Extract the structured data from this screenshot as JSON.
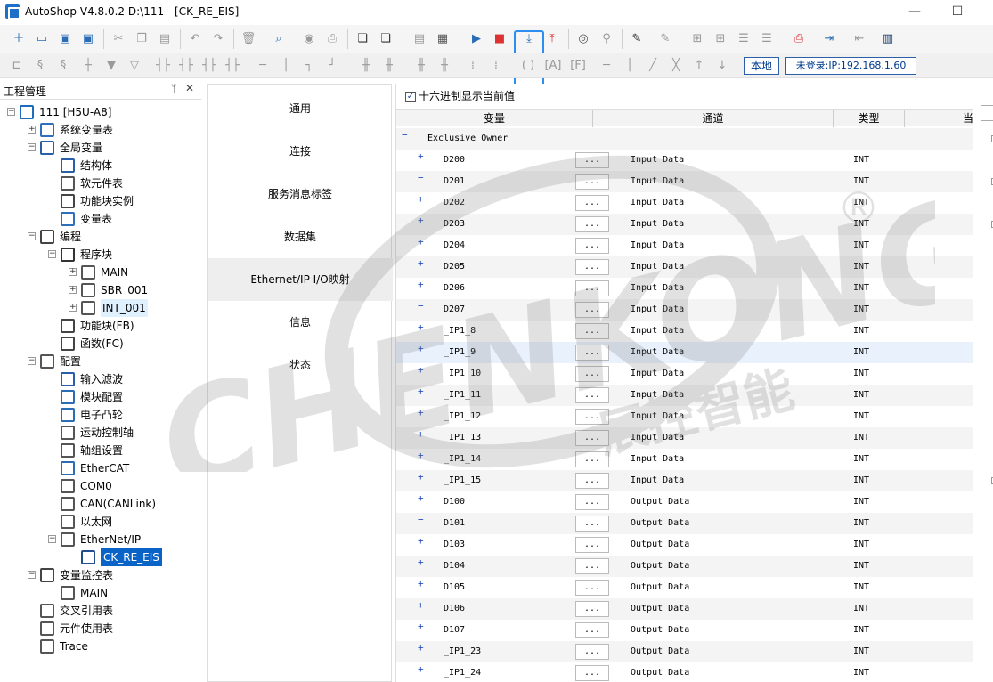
{
  "window": {
    "title": "AutoShop V4.8.0.2  D:\\111 - [CK_RE_EIS]",
    "minimize": "—",
    "maximize": "☐"
  },
  "toolbar": {
    "local_label": "本地",
    "login_label": "未登录:IP:192.168.1.60",
    "icons": [
      "new-file-icon",
      "open-folder-icon",
      "save-icon",
      "save-all-icon",
      "cut-icon",
      "copy-icon",
      "paste-icon",
      "undo-icon",
      "redo-icon",
      "delete-icon",
      "search-icon",
      "monitor-icon",
      "print-icon",
      "window-icon",
      "window-export-icon",
      "document-icon",
      "compile-icon",
      "run-icon",
      "stop-icon",
      "download-icon",
      "upload-icon",
      "debug-icon",
      "test-icon",
      "edit-icon",
      "tools-icon",
      "ladder-icon",
      "test-mode-icon",
      "login-icon",
      "logout-icon",
      "module-icon"
    ]
  },
  "panel": {
    "title": "工程管理",
    "pin": "ᛘ",
    "close": "✕"
  },
  "tree": [
    {
      "label": "111 [H5U-A8]",
      "indent": 0,
      "exp": "−",
      "icon": "plc-monitor-icon"
    },
    {
      "label": "系统变量表",
      "indent": 1,
      "exp": "+",
      "icon": "globe-variable-icon"
    },
    {
      "label": "全局变量",
      "indent": 1,
      "exp": "−",
      "icon": "global-variable-icon"
    },
    {
      "label": "结构体",
      "indent": 2,
      "exp": "",
      "icon": "struct-icon"
    },
    {
      "label": "软元件表",
      "indent": 2,
      "exp": "",
      "icon": "device-table-icon"
    },
    {
      "label": "功能块实例",
      "indent": 2,
      "exp": "",
      "icon": "fb-instance-icon"
    },
    {
      "label": "变量表",
      "indent": 2,
      "exp": "",
      "icon": "variable-table-icon"
    },
    {
      "label": "编程",
      "indent": 1,
      "exp": "−",
      "icon": "ladder-program-icon"
    },
    {
      "label": "程序块",
      "indent": 2,
      "exp": "−",
      "icon": "program-block-icon"
    },
    {
      "label": "MAIN",
      "indent": 3,
      "exp": "+",
      "icon": "main-program-icon"
    },
    {
      "label": "SBR_001",
      "indent": 3,
      "exp": "+",
      "icon": "subroutine-icon"
    },
    {
      "label": "INT_001",
      "indent": 3,
      "exp": "+",
      "icon": "interrupt-icon",
      "soft": true
    },
    {
      "label": "功能块(FB)",
      "indent": 2,
      "exp": "",
      "icon": "function-block-icon"
    },
    {
      "label": "函数(FC)",
      "indent": 2,
      "exp": "",
      "icon": "function-icon"
    },
    {
      "label": "配置",
      "indent": 1,
      "exp": "−",
      "icon": "config-icon"
    },
    {
      "label": "输入滤波",
      "indent": 2,
      "exp": "",
      "icon": "input-filter-icon"
    },
    {
      "label": "模块配置",
      "indent": 2,
      "exp": "",
      "icon": "module-config-icon"
    },
    {
      "label": "电子凸轮",
      "indent": 2,
      "exp": "",
      "icon": "cam-icon"
    },
    {
      "label": "运动控制轴",
      "indent": 2,
      "exp": "",
      "icon": "motion-axis-icon"
    },
    {
      "label": "轴组设置",
      "indent": 2,
      "exp": "",
      "icon": "axis-group-icon"
    },
    {
      "label": "EtherCAT",
      "indent": 2,
      "exp": "",
      "icon": "ethercat-icon"
    },
    {
      "label": "COM0",
      "indent": 2,
      "exp": "",
      "icon": "serial-port-icon"
    },
    {
      "label": "CAN(CANLink)",
      "indent": 2,
      "exp": "",
      "icon": "can-network-icon"
    },
    {
      "label": "以太网",
      "indent": 2,
      "exp": "",
      "icon": "ethernet-icon"
    },
    {
      "label": "EtherNet/IP",
      "indent": 2,
      "exp": "−",
      "icon": "ethernet-ip-icon"
    },
    {
      "label": "CK_RE_EIS",
      "indent": 3,
      "exp": "",
      "icon": "device-icon",
      "selected": true
    },
    {
      "label": "变量监控表",
      "indent": 1,
      "exp": "−",
      "icon": "monitor-table-icon"
    },
    {
      "label": "MAIN",
      "indent": 2,
      "exp": "",
      "icon": "table-icon"
    },
    {
      "label": "交叉引用表",
      "indent": 1,
      "exp": "",
      "icon": "cross-reference-icon"
    },
    {
      "label": "元件使用表",
      "indent": 1,
      "exp": "",
      "icon": "element-usage-icon"
    },
    {
      "label": "Trace",
      "indent": 1,
      "exp": "",
      "icon": "trace-icon"
    }
  ],
  "tabs": [
    {
      "label": "通用",
      "active": false
    },
    {
      "label": "连接",
      "active": false
    },
    {
      "label": "服务消息标签",
      "active": false
    },
    {
      "label": "数据集",
      "active": false
    },
    {
      "label": "Ethernet/IP I/O映射",
      "active": true
    },
    {
      "label": "信息",
      "active": false
    },
    {
      "label": "状态",
      "active": false
    }
  ],
  "content": {
    "hex_checkbox_label": "十六进制显示当前值",
    "hex_checked": true,
    "columns": [
      "变量",
      "通道",
      "类型",
      "当"
    ],
    "group": "Exclusive Owner",
    "group_exp": "−",
    "button_label": "...",
    "rows": [
      {
        "var": "D200",
        "channel": "Input Data",
        "type": "INT",
        "exp": "+"
      },
      {
        "var": "D201",
        "channel": "Input Data",
        "type": "INT",
        "exp": "−"
      },
      {
        "var": "D202",
        "channel": "Input Data",
        "type": "INT",
        "exp": "+"
      },
      {
        "var": "D203",
        "channel": "Input Data",
        "type": "INT",
        "exp": "+"
      },
      {
        "var": "D204",
        "channel": "Input Data",
        "type": "INT",
        "exp": "+"
      },
      {
        "var": "D205",
        "channel": "Input Data",
        "type": "INT",
        "exp": "+"
      },
      {
        "var": "D206",
        "channel": "Input Data",
        "type": "INT",
        "exp": "+"
      },
      {
        "var": "D207",
        "channel": "Input Data",
        "type": "INT",
        "exp": "−"
      },
      {
        "var": "_IP1_8",
        "channel": "Input Data",
        "type": "INT",
        "exp": "+"
      },
      {
        "var": "_IP1_9",
        "channel": "Input Data",
        "type": "INT",
        "exp": "+",
        "hover": true
      },
      {
        "var": "_IP1_10",
        "channel": "Input Data",
        "type": "INT",
        "exp": "+"
      },
      {
        "var": "_IP1_11",
        "channel": "Input Data",
        "type": "INT",
        "exp": "+"
      },
      {
        "var": "_IP1_12",
        "channel": "Input Data",
        "type": "INT",
        "exp": "+"
      },
      {
        "var": "_IP1_13",
        "channel": "Input Data",
        "type": "INT",
        "exp": "+"
      },
      {
        "var": "_IP1_14",
        "channel": "Input Data",
        "type": "INT",
        "exp": "+"
      },
      {
        "var": "_IP1_15",
        "channel": "Input Data",
        "type": "INT",
        "exp": "+"
      },
      {
        "var": "D100",
        "channel": "Output Data",
        "type": "INT",
        "exp": "+"
      },
      {
        "var": "D101",
        "channel": "Output Data",
        "type": "INT",
        "exp": "−"
      },
      {
        "var": "D103",
        "channel": "Output Data",
        "type": "INT",
        "exp": "+"
      },
      {
        "var": "D104",
        "channel": "Output Data",
        "type": "INT",
        "exp": "+"
      },
      {
        "var": "D105",
        "channel": "Output Data",
        "type": "INT",
        "exp": "+"
      },
      {
        "var": "D106",
        "channel": "Output Data",
        "type": "INT",
        "exp": "+"
      },
      {
        "var": "D107",
        "channel": "Output Data",
        "type": "INT",
        "exp": "+"
      },
      {
        "var": "_IP1_23",
        "channel": "Output Data",
        "type": "INT",
        "exp": "+"
      },
      {
        "var": "_IP1_24",
        "channel": "Output Data",
        "type": "INT",
        "exp": "+"
      }
    ]
  },
  "watermark": {
    "text": "CHENKONG",
    "subtext": "辰控智能",
    "mark": "®",
    "color": "#7a7a7a"
  }
}
